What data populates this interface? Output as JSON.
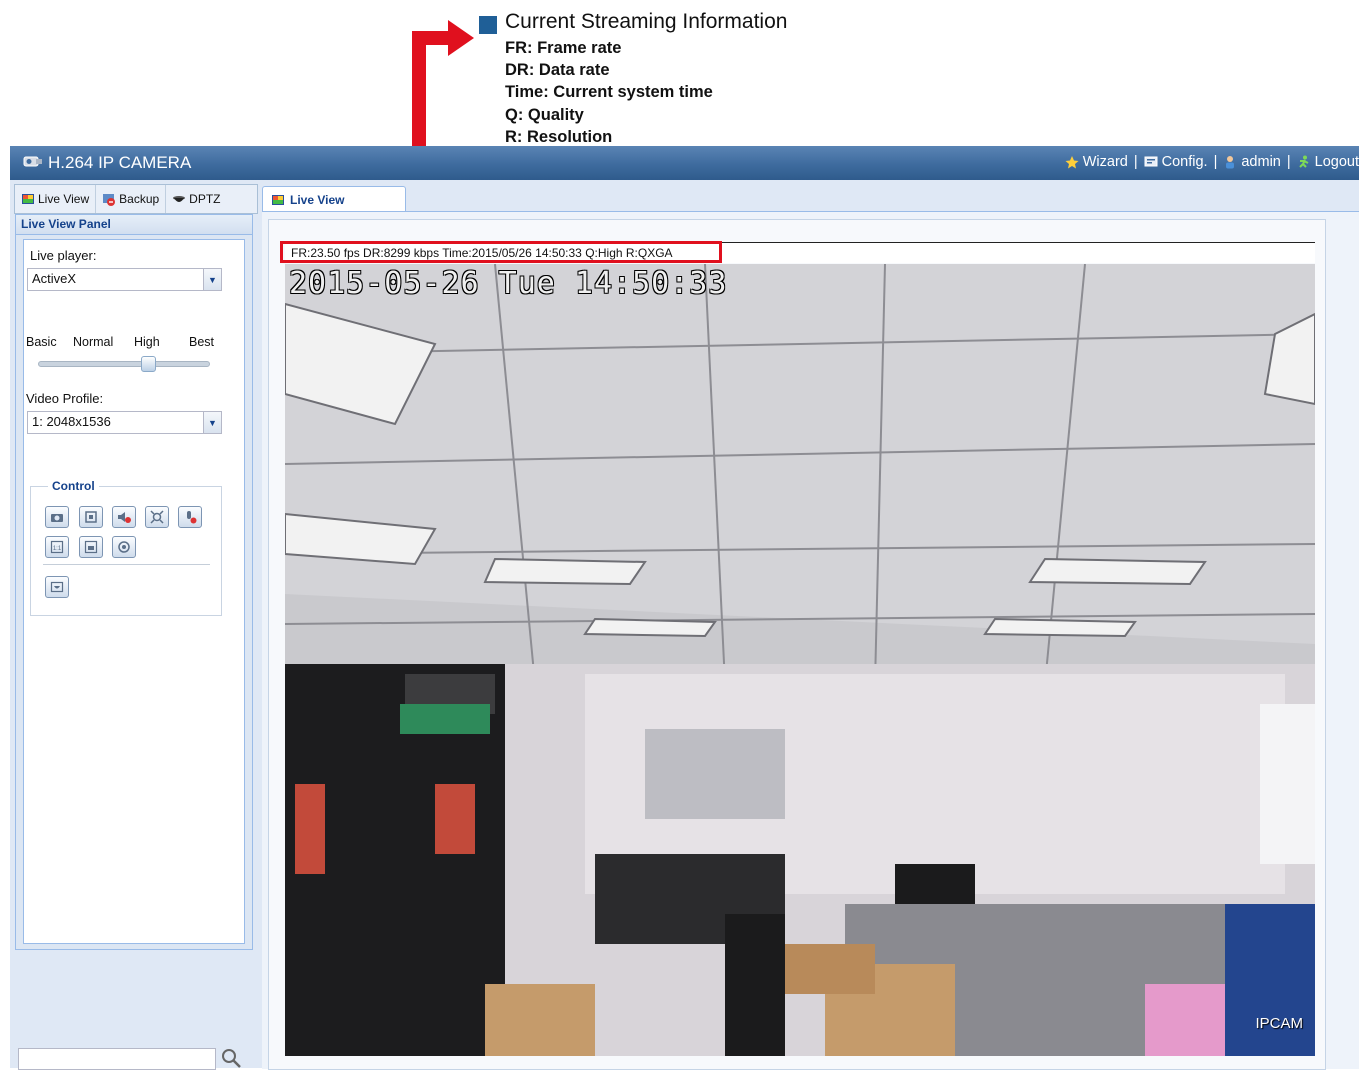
{
  "callout": {
    "title": "Current Streaming Information",
    "lines": [
      "FR: Frame rate",
      "DR: Data rate",
      "Time: Current system time",
      "Q: Quality",
      "R: Resolution"
    ],
    "square_color": "#1f5f97",
    "arrow_color": "#e0101e"
  },
  "header": {
    "title": "H.264 IP CAMERA",
    "nav": {
      "wizard": "Wizard",
      "config": "Config.",
      "user": "admin",
      "logout": "Logout"
    }
  },
  "left": {
    "tabs": {
      "live_view": "Live View",
      "backup": "Backup",
      "dptz": "DPTZ"
    },
    "panel_title": "Live View Panel",
    "live_player_label": "Live player:",
    "live_player_value": "ActiveX",
    "quality_levels": [
      "Basic",
      "Normal",
      "High",
      "Best"
    ],
    "quality_selected": "High",
    "video_profile_label": "Video Profile:",
    "video_profile_value": "1: 2048x1536",
    "control_legend": "Control",
    "control_icons": [
      "snapshot-icon",
      "fullscreen-icon",
      "audio-mute-icon",
      "digital-zoom-icon",
      "microphone-mute-icon",
      "original-size-icon",
      "fit-window-icon",
      "ptz-icon",
      "dptz-view-icon"
    ]
  },
  "main": {
    "tab_label": "Live View",
    "stream_info": "FR:23.50 fps  DR:8299 kbps Time:2015/05/26 14:50:33 Q:High R:QXGA",
    "osd_timestamp": "2015-05-26 Tue 14:50:33",
    "watermark": "IPCAM"
  }
}
